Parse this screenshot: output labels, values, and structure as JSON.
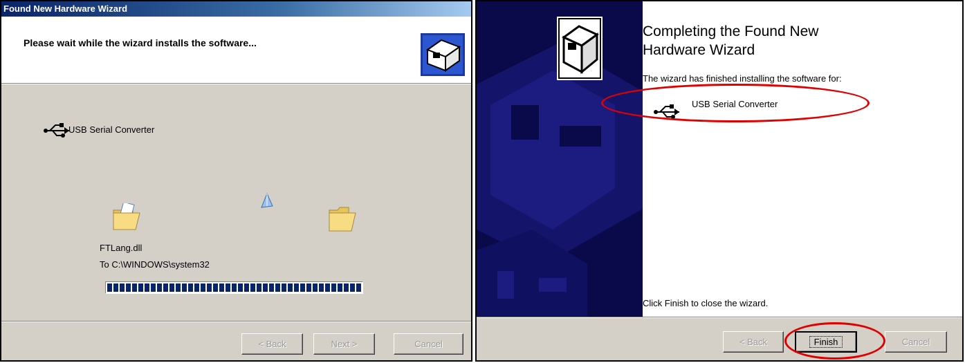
{
  "left_dialog": {
    "title": "Found New Hardware Wizard",
    "header": "Please wait while the wizard installs the software...",
    "device_name": "USB Serial Converter",
    "file_name": "FTLang.dll",
    "file_destination": "To C:\\WINDOWS\\system32",
    "progress_fraction": 1.0,
    "buttons": {
      "back": "< Back",
      "next": "Next >",
      "cancel": "Cancel"
    }
  },
  "right_dialog": {
    "title": "Completing the Found New Hardware Wizard",
    "title_line1": "Completing the Found New",
    "title_line2": "Hardware Wizard",
    "finished_text": "The wizard has finished installing the software for:",
    "device_name": "USB Serial Converter",
    "close_instruction": "Click Finish to close the wizard.",
    "buttons": {
      "back": "< Back",
      "finish": "Finish",
      "cancel": "Cancel"
    }
  },
  "colors": {
    "titlebar": "#0a246a",
    "dialog_bg": "#d4d0c8",
    "highlight_ellipse": "#e00000",
    "sidebar": "#0a0a4a"
  },
  "icons": [
    "hardware-wizard-icon",
    "usb-icon",
    "folder-open-icon",
    "folder-icon",
    "paper-icon"
  ]
}
